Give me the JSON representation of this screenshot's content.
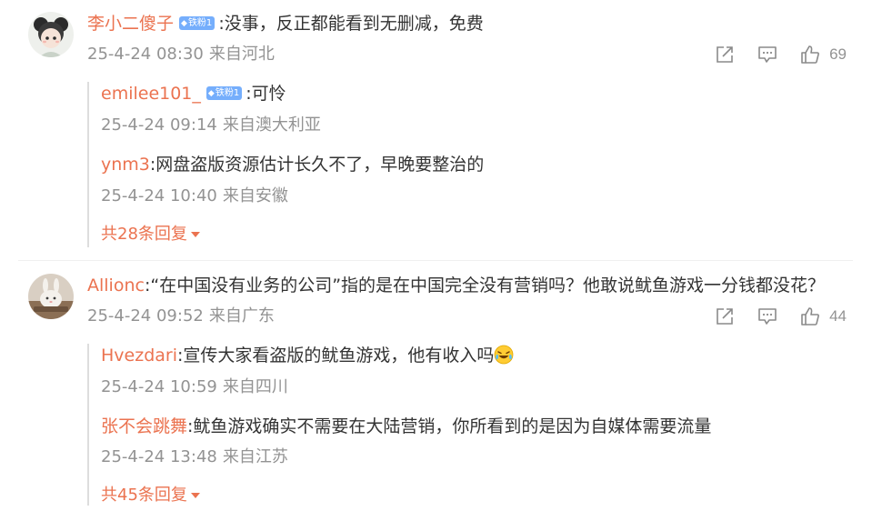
{
  "comments": [
    {
      "user": "李小二傻子",
      "badge": "铁粉1",
      "text": ":没事，反正都能看到无删减，免费",
      "date": "25-4-24 08:30",
      "location": "来自河北",
      "likes": "69",
      "replies": [
        {
          "user": "emilee101_",
          "badge": "铁粉1",
          "text": ":可怜",
          "date": "25-4-24 09:14",
          "location": "来自澳大利亚"
        },
        {
          "user": "ynm3",
          "text": ":网盘盗版资源估计长久不了，早晚要整治的",
          "date": "25-4-24 10:40",
          "location": "来自安徽"
        }
      ],
      "more_label": "共28条回复"
    },
    {
      "user": "Allionc",
      "text": ":“在中国没有业务的公司”指的是在中国完全没有营销吗？他敢说鱿鱼游戏一分钱都没花？",
      "date": "25-4-24 09:52",
      "location": "来自广东",
      "likes": "44",
      "replies": [
        {
          "user": "Hvezdari",
          "text": ":宣传大家看盗版的鱿鱼游戏，他有收入吗",
          "emoji": "laugh-cry-emoji",
          "date": "25-4-24 10:59",
          "location": "来自四川"
        },
        {
          "user": "张不会跳舞",
          "text": ":鱿鱼游戏确实不需要在大陆营销，你所看到的是因为自媒体需要流量",
          "date": "25-4-24 13:48",
          "location": "来自江苏"
        }
      ],
      "more_label": "共45条回复"
    }
  ],
  "icons": {
    "share": "share-icon",
    "comment": "comment-icon",
    "like": "thumbs-up-icon",
    "badge": "diamond-icon"
  },
  "colors": {
    "username": "#eb7350",
    "meta": "#939393",
    "badge": "#75aefc",
    "text": "#333333"
  }
}
